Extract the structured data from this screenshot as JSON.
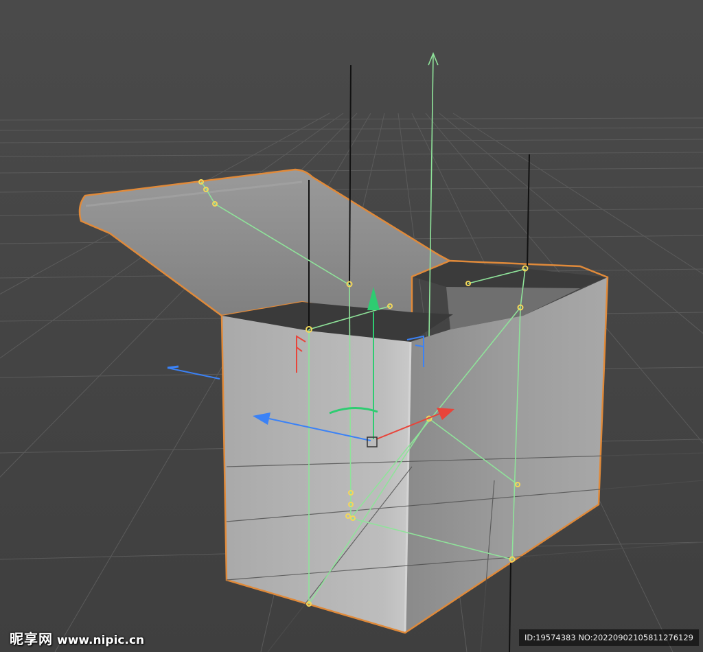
{
  "viewport": {
    "background": "#474747",
    "grid_color": "#5c5c5c",
    "object_outline_color": "#e08a3a",
    "face_colors": {
      "front": "#b4b4b4",
      "right": "#9a9a9a",
      "lid": "#888888",
      "dark_top": "#3a3a3a"
    },
    "axis_colors": {
      "x": "#e8443a",
      "y": "#2ecc71",
      "z": "#3b82f6"
    },
    "guide_color": "#8fe39a",
    "vertex_color": "#f2d75a"
  },
  "watermark": {
    "logo_text": "昵享网",
    "url": "www.nipic.cn",
    "id_text": "ID:19574383 NO:20220902105811276129"
  }
}
